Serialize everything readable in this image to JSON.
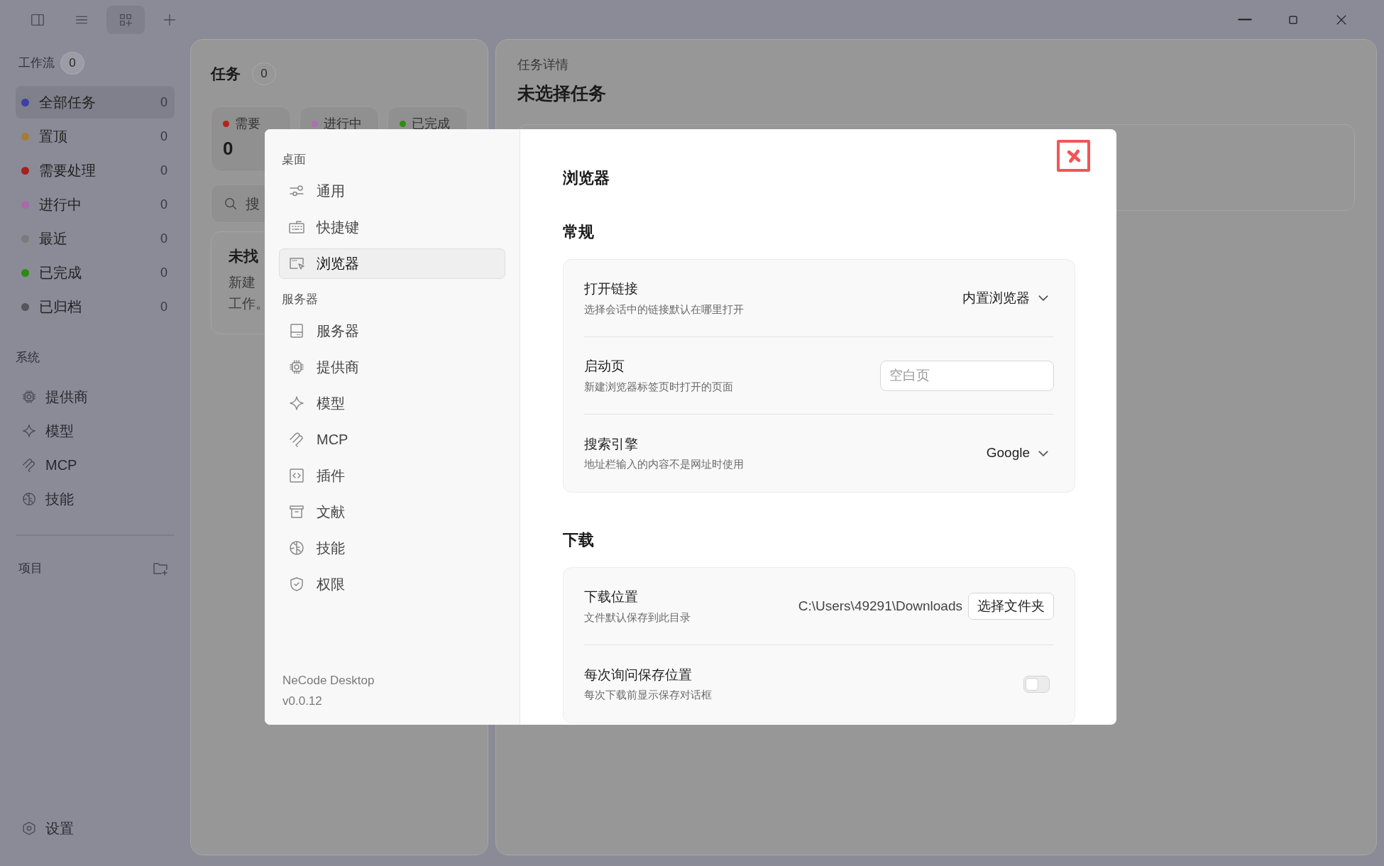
{
  "titlebar": {
    "tools": [
      {
        "kind": "sidebar",
        "selected": false
      },
      {
        "kind": "list",
        "selected": false
      },
      {
        "kind": "grid-add",
        "selected": true
      },
      {
        "kind": "plus",
        "selected": false
      }
    ]
  },
  "sidebar": {
    "workflow": {
      "title": "工作流",
      "count": "0",
      "items": [
        {
          "label": "全部任务",
          "count": "0",
          "color": "#3c40a4",
          "selected": true
        },
        {
          "label": "置顶",
          "count": "0",
          "color": "#a67c34",
          "selected": false
        },
        {
          "label": "需要处理",
          "count": "0",
          "color": "#a2221c",
          "selected": false
        },
        {
          "label": "进行中",
          "count": "0",
          "color": "#a86aa9",
          "selected": false
        },
        {
          "label": "最近",
          "count": "0",
          "color": "#7b7b7b",
          "selected": false
        },
        {
          "label": "已完成",
          "count": "0",
          "color": "#2d8a12",
          "selected": false
        },
        {
          "label": "已归档",
          "count": "0",
          "color": "#55565a",
          "selected": false
        }
      ]
    },
    "system": {
      "title": "系统",
      "items": [
        {
          "label": "提供商",
          "kind": "chip"
        },
        {
          "label": "模型",
          "kind": "sparkle"
        },
        {
          "label": "MCP",
          "kind": "mcp"
        },
        {
          "label": "技能",
          "kind": "brain"
        }
      ]
    },
    "projects": {
      "title": "项目"
    },
    "settings": {
      "label": "设置"
    }
  },
  "tasks_panel": {
    "title": "任务",
    "count": "0",
    "stats": [
      {
        "label": "需要",
        "color": "#b5231b",
        "value": "0"
      },
      {
        "label": "进行中",
        "color": "#ad6fb0"
      },
      {
        "label": "已完成",
        "color": "#2f8c14"
      }
    ],
    "search": {
      "placeholder": "搜"
    },
    "empty": {
      "title": "未找",
      "lines": [
        "新建",
        "工作。"
      ]
    }
  },
  "detail_panel": {
    "subtitle": "任务详情",
    "title": "未选择任务"
  },
  "settings_dialog": {
    "nav": [
      {
        "heading": "桌面",
        "items": [
          {
            "label": "通用",
            "kind": "sliders",
            "selected": false
          },
          {
            "label": "快捷键",
            "kind": "keyboard",
            "selected": false
          },
          {
            "label": "浏览器",
            "kind": "browser",
            "selected": true
          }
        ]
      },
      {
        "heading": "服务器",
        "items": [
          {
            "label": "服务器",
            "kind": "server",
            "selected": false
          },
          {
            "label": "提供商",
            "kind": "chip",
            "selected": false
          },
          {
            "label": "模型",
            "kind": "sparkle",
            "selected": false
          },
          {
            "label": "MCP",
            "kind": "mcp",
            "selected": false
          },
          {
            "label": "插件",
            "kind": "plugin",
            "selected": false
          },
          {
            "label": "文献",
            "kind": "archive",
            "selected": false
          },
          {
            "label": "技能",
            "kind": "brain",
            "selected": false
          },
          {
            "label": "权限",
            "kind": "shield",
            "selected": false
          }
        ]
      }
    ],
    "app_name": "NeCode Desktop",
    "version": "v0.0.12",
    "title": "浏览器",
    "sections": [
      {
        "title": "常规",
        "rows": [
          {
            "kind": "select",
            "label": "打开链接",
            "description": "选择会话中的链接默认在哪里打开",
            "value": "内置浏览器"
          },
          {
            "kind": "input",
            "label": "启动页",
            "description": "新建浏览器标签页时打开的页面",
            "placeholder": "空白页"
          },
          {
            "kind": "select",
            "label": "搜索引擎",
            "description": "地址栏输入的内容不是网址时使用",
            "value": "Google"
          }
        ]
      },
      {
        "title": "下载",
        "rows": [
          {
            "kind": "path",
            "label": "下载位置",
            "description": "文件默认保存到此目录",
            "value": "C:\\Users\\49291\\Downloads",
            "button": "选择文件夹"
          },
          {
            "kind": "toggle",
            "label": "每次询问保存位置",
            "description": "每次下载前显示保存对话框",
            "on": false
          }
        ]
      }
    ]
  }
}
